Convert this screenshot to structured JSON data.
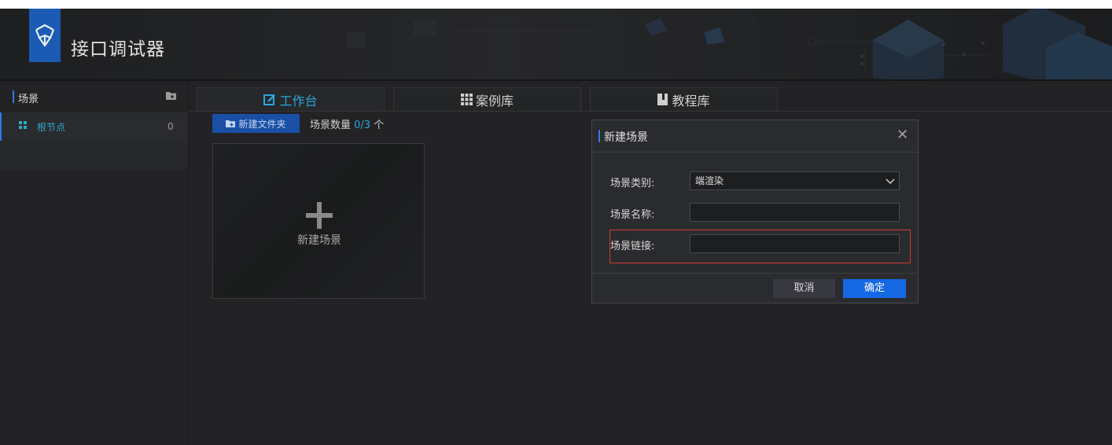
{
  "app": {
    "title": "接口调试器",
    "logo_icon": "cube-shield-icon",
    "brand_color": "#1c5bb4"
  },
  "sidebar": {
    "title": "场景",
    "header_icon": "new-folder-icon",
    "items": [
      {
        "label": "根节点",
        "count": "0",
        "icon": "grid-icon"
      }
    ]
  },
  "tabs": [
    {
      "label": "工作台",
      "icon": "edit-icon",
      "active": true
    },
    {
      "label": "案例库",
      "icon": "grid-icon",
      "active": false
    },
    {
      "label": "教程库",
      "icon": "book-icon",
      "active": false
    }
  ],
  "toolbar": {
    "new_folder_label": "新建文件夹",
    "scene_count_prefix": "场景数量",
    "scene_count_value": "0/3",
    "scene_count_suffix": "个"
  },
  "new_scene_card": {
    "label": "新建场景",
    "icon": "plus-icon"
  },
  "dialog": {
    "title": "新建场景",
    "close_icon": "close-icon",
    "fields": {
      "category_label": "场景类别:",
      "category_value": "端渲染",
      "name_label": "场景名称:",
      "name_value": "",
      "link_label": "场景链接:",
      "link_value": ""
    },
    "cancel_label": "取消",
    "ok_label": "确定"
  },
  "colors": {
    "accent": "#2a7bea",
    "primary_button": "#1668e3",
    "highlight": "#d33a35"
  }
}
